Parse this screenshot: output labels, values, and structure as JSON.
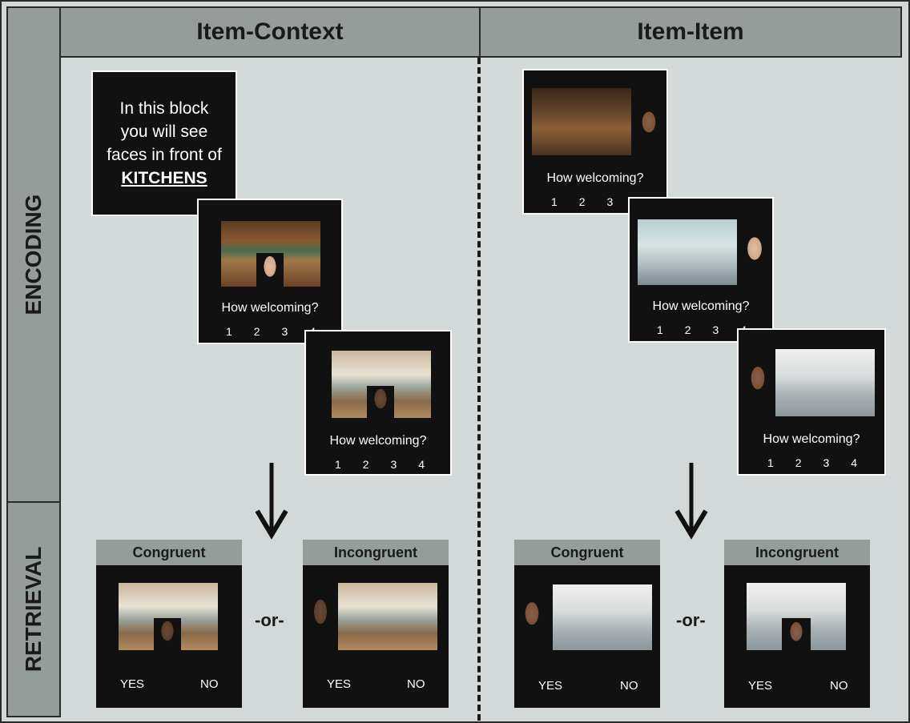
{
  "headers": {
    "left": "Item-Context",
    "right": "Item-Item"
  },
  "phases": {
    "encoding": "ENCODING",
    "retrieval": "RETRIEVAL"
  },
  "instruction": {
    "line1": "In this block",
    "line2": "you will see",
    "line3": "faces in front of",
    "keyword": "KITCHENS"
  },
  "question": "How welcoming?",
  "scale": [
    "1",
    "2",
    "3",
    "4"
  ],
  "retrieval": {
    "congruent": "Congruent",
    "incongruent": "Incongruent",
    "or": "-or-",
    "yes": "YES",
    "no": "NO"
  }
}
